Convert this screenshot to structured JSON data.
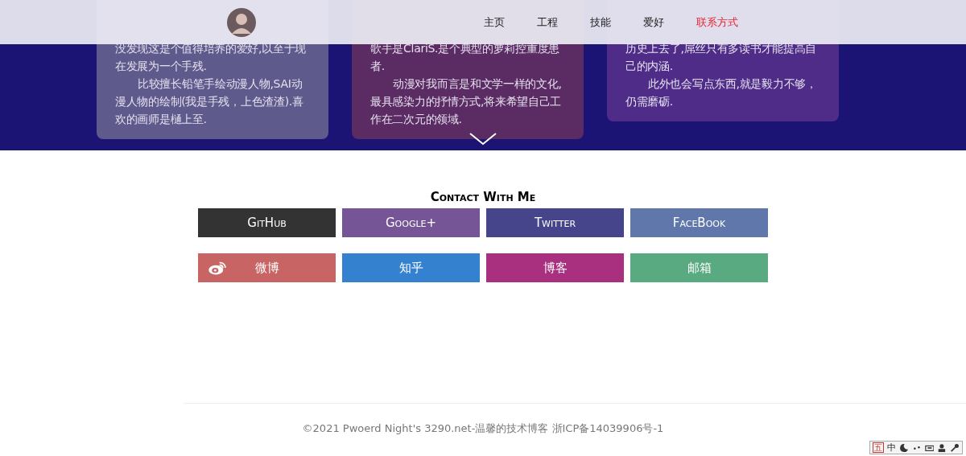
{
  "nav": {
    "items": [
      {
        "label": "主页",
        "selected": false
      },
      {
        "label": "工程",
        "selected": false
      },
      {
        "label": "技能",
        "selected": false
      },
      {
        "label": "爱好",
        "selected": false
      },
      {
        "label": "联系方式",
        "selected": true
      }
    ]
  },
  "hero": {
    "cards": [
      {
        "color": "#5f5a8c",
        "paragraphs": [
          "没发现这是个值得培养的爱好,以至于现在发展为一个手残.",
          "比较擅长铅笔手绘动漫人物,SAI动漫人物的绘制(我是手残，上色渣渣).喜欢的画师是樋上至."
        ]
      },
      {
        "color": "#5b2b63",
        "paragraphs": [
          "歌手是ClariS.是个典型的萝莉控重度患者.",
          "动漫对我而言是和文学一样的文化,最具感染力的抒情方式,将来希望自己工作在二次元的领域."
        ]
      },
      {
        "color": "#4f2c88",
        "paragraphs": [
          "历史上去了,屌丝只有多读书才能提高自己的内涵.",
          "此外也会写点东西,就是毅力不够，仍需磨砺."
        ]
      }
    ]
  },
  "contact": {
    "title": "Contact With Me",
    "buttons": [
      {
        "label": "GitHub",
        "color": "#333333",
        "kind": "plain"
      },
      {
        "label": "Google+",
        "color": "#765597",
        "kind": "plain"
      },
      {
        "label": "Twitter",
        "color": "#46458c",
        "kind": "plain"
      },
      {
        "label": "FaceBook",
        "color": "#5f77ab",
        "kind": "plain"
      },
      {
        "label": "微博",
        "color": "#c86464",
        "kind": "weibo"
      },
      {
        "label": "知乎",
        "color": "#3481cf",
        "kind": "plain"
      },
      {
        "label": "博客",
        "color": "#a8307e",
        "kind": "plain"
      },
      {
        "label": "邮箱",
        "color": "#5aaa81",
        "kind": "plain"
      }
    ]
  },
  "footer": {
    "text": "©2021 Pwoerd Night's 3290.net-温馨的技术博客 浙ICP备14039906号-1"
  },
  "ime_toolbar": {
    "mode": "五",
    "language": "中"
  }
}
